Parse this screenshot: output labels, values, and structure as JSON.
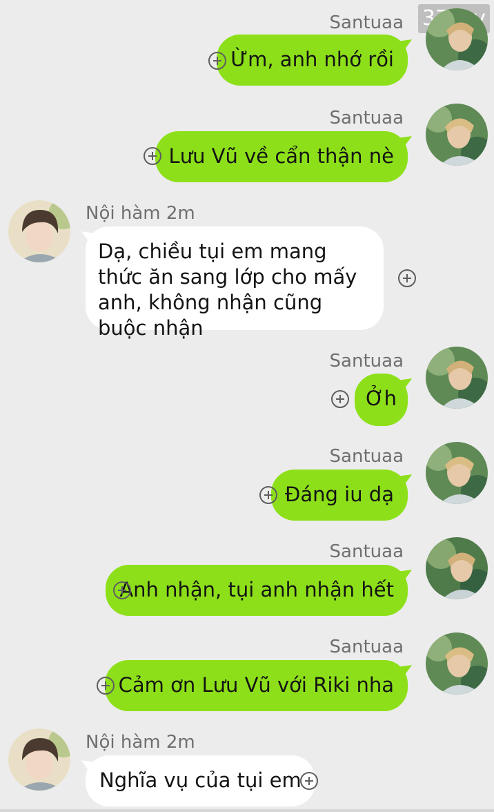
{
  "watermark": "37 joy",
  "messages": [
    {
      "sender": "Santuaa",
      "side": "right",
      "text": "Ừm, anh nhớ rồi"
    },
    {
      "sender": "Santuaa",
      "side": "right",
      "text": "Lưu Vũ về cẩn thận nè"
    },
    {
      "sender": "Nội hàm 2m",
      "side": "left",
      "text": "Dạ, chiều tụi em mang thức ăn sang lớp cho mấy anh, không nhận cũng buộc nhận"
    },
    {
      "sender": "Santuaa",
      "side": "right",
      "text": "Ởh"
    },
    {
      "sender": "Santuaa",
      "side": "right",
      "text": "Đáng iu dạ"
    },
    {
      "sender": "Santuaa",
      "side": "right",
      "text": "Anh nhận, tụi anh nhận hết"
    },
    {
      "sender": "Santuaa",
      "side": "right",
      "text": "Cảm ơn Lưu Vũ với Riki nha"
    },
    {
      "sender": "Nội hàm 2m",
      "side": "left",
      "text": "Nghĩa vụ của tụi em"
    }
  ],
  "colors": {
    "background": "#ececec",
    "bubble_sent": "#8de019",
    "bubble_received": "#ffffff"
  },
  "icons": {
    "add": "plus-circle-icon",
    "avatar_santuaa": "avatar",
    "avatar_noiham": "avatar"
  }
}
